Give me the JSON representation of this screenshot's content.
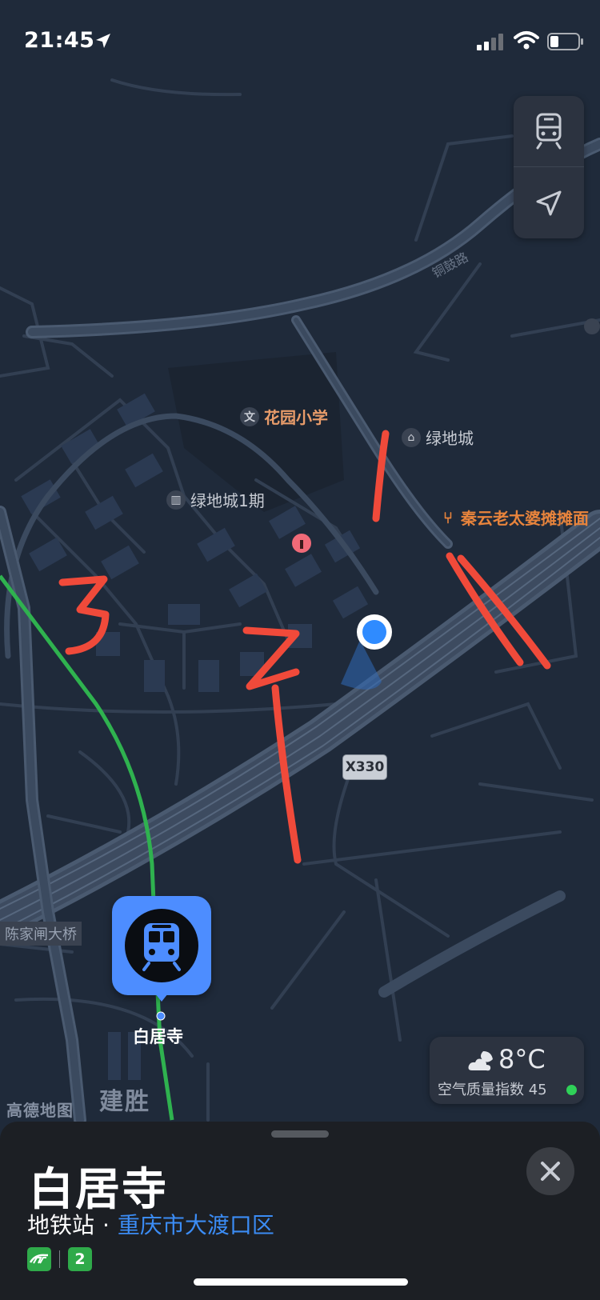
{
  "status_bar": {
    "time": "21:45",
    "icons": [
      "location-arrow-icon",
      "cellular-signal-icon",
      "wifi-icon",
      "battery-icon"
    ]
  },
  "map_controls": {
    "icons": [
      "transit-icon",
      "locate-icon"
    ]
  },
  "map": {
    "poi_school": "花园小学",
    "poi_residential": "绿地城",
    "poi_restaurant": "秦云老太婆摊摊面",
    "poi_phase1": "绿地城1期",
    "road_label": "铜鼓路",
    "road_shield": "X330",
    "bridge_label": "陈家闸大桥",
    "area_label": "建胜",
    "watermark": "高德地图",
    "station_name": "白居寺",
    "annotations": [
      "1",
      "2",
      "3"
    ],
    "colors": {
      "metro_line": "#2fb24f",
      "station_marker": "#4d8dff",
      "user_location": "#2f8bff",
      "annotation": "#f04a3a"
    }
  },
  "weather": {
    "temperature": "8°C",
    "aqi_label": "空气质量指数 45",
    "aqi_status_color": "#2fd158"
  },
  "place_sheet": {
    "title": "白居寺",
    "type": "地铁站",
    "separator": "·",
    "district": "重庆市大渡口区",
    "badges": {
      "brt": "BRT",
      "line": "2"
    },
    "colors": {
      "district_link": "#3b8cf5",
      "line_badge": "#2faa4a"
    }
  }
}
